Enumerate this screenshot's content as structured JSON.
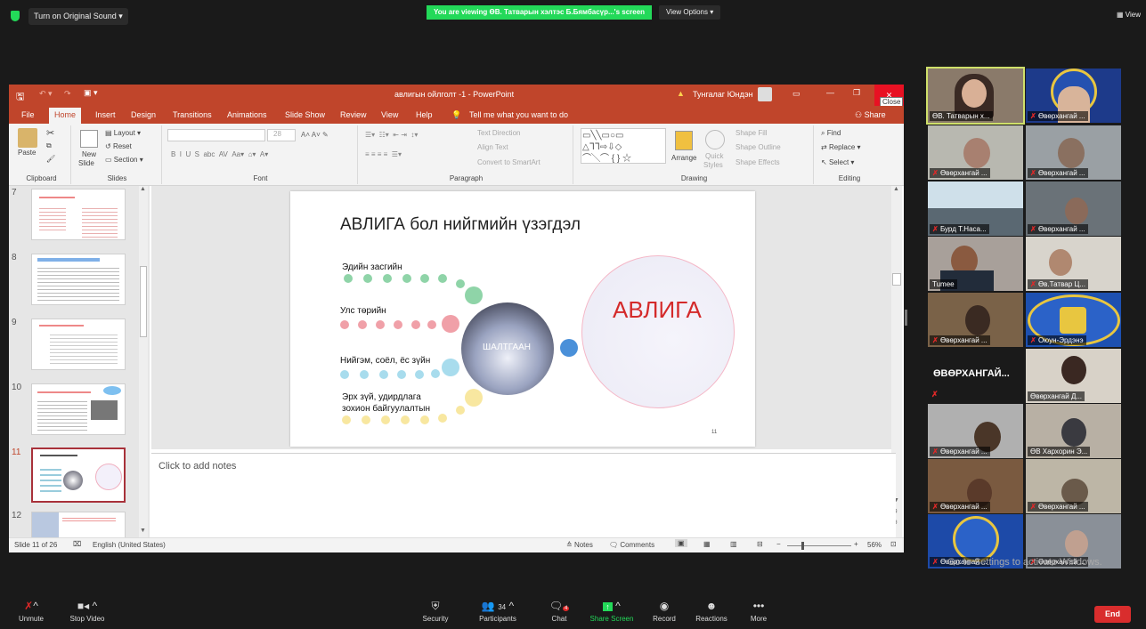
{
  "zoom_top": {
    "sound_label": "Turn on Original Sound",
    "viewing_banner": "You are viewing ӨВ. Татварын хэлтэс Б.Бямбасүр...'s screen",
    "view_options": "View Options",
    "view_label": "View"
  },
  "ppt": {
    "window_title": "авлигын ойлголт -1 - PowerPoint",
    "user_name": "Тунгалаг Юндэн",
    "close_tooltip": "Close",
    "tabs": [
      "File",
      "Home",
      "Insert",
      "Design",
      "Transitions",
      "Animations",
      "Slide Show",
      "Review",
      "View",
      "Help"
    ],
    "tell_me": "Tell me what you want to do",
    "share": "Share",
    "ribbon": {
      "paste": "Paste",
      "layout": "Layout",
      "reset": "Reset",
      "new_slide": "New",
      "new_slide2": "Slide",
      "section": "Section",
      "clipboard": "Clipboard",
      "slides": "Slides",
      "font_size": "28",
      "font": "Font",
      "text_direction": "Text Direction",
      "align_text": "Align Text",
      "convert_smartart": "Convert to SmartArt",
      "paragraph": "Paragraph",
      "arrange": "Arrange",
      "quick_styles": "Quick",
      "quick_styles2": "Styles",
      "shape_fill": "Shape Fill",
      "shape_outline": "Shape Outline",
      "shape_effects": "Shape Effects",
      "drawing": "Drawing",
      "find": "Find",
      "replace": "Replace",
      "select": "Select",
      "editing": "Editing"
    },
    "thumb_numbers": [
      "7",
      "8",
      "9",
      "10",
      "11",
      "12"
    ],
    "slide": {
      "title": "АВЛИГА бол нийгмийн үзэгдэл",
      "row1": "Эдийн засгийн",
      "row2": "Улс төрийн",
      "row3": "Нийгэм, соёл, ёс зүйн",
      "row4a": "Эрх зүй, удирдлага",
      "row4b": "зохион байгуулалтын",
      "center": "ШАЛТГААН",
      "avliga": "АВЛИГА",
      "page_number": "11"
    },
    "notes_placeholder": "Click to add notes",
    "status": {
      "slide_of": "Slide 11 of 26",
      "language": "English (United States)",
      "notes": "Notes",
      "comments": "Comments",
      "zoom": "56%"
    }
  },
  "gallery": [
    {
      "name": "ӨВ. Татварын х..."
    },
    {
      "name": "Өвөрхангай ..."
    },
    {
      "name": "Өвөрхангай ..."
    },
    {
      "name": "Өвөрхангай ..."
    },
    {
      "name": "Бурд Т.Наса..."
    },
    {
      "name": "Өвөрхангай ..."
    },
    {
      "name": "Tumee"
    },
    {
      "name": "Өв.Татвар Ц..."
    },
    {
      "name": "Өвөрхангай ..."
    },
    {
      "name": "Оюун-Эрдэнэ"
    },
    {
      "name": "ӨВӨРХАНГАЙ..."
    },
    {
      "name": "Өвөрхангай Д..."
    },
    {
      "name": "Өвөрхангай ..."
    },
    {
      "name": "ӨВ Хархорин Э..."
    },
    {
      "name": "Өвөрхангай ..."
    },
    {
      "name": "Өвөрхангай ..."
    },
    {
      "name": "Өвөрхангай ..."
    },
    {
      "name": "Өвөрхангай ..."
    }
  ],
  "windows_activate": "Go to Settings to activate Windows.",
  "bottom": {
    "unmute": "Unmute",
    "stop_video": "Stop Video",
    "security": "Security",
    "participants": "Participants",
    "participants_count": "34",
    "chat": "Chat",
    "chat_badge": "4",
    "share_screen": "Share Screen",
    "record": "Record",
    "reactions": "Reactions",
    "more": "More",
    "end": "End"
  },
  "colors": {
    "ppt_accent": "#c0452b",
    "zoom_green": "#23d959",
    "end_red": "#d92d2d",
    "avliga_red": "#d42a2a"
  }
}
